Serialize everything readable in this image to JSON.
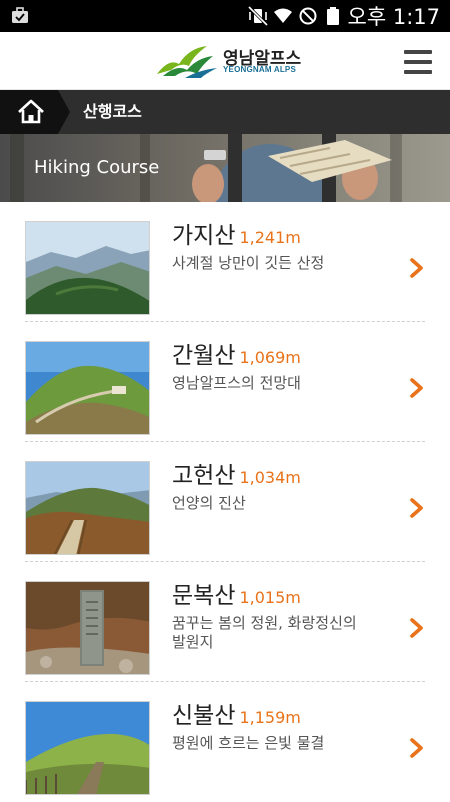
{
  "status_bar": {
    "time": "오후 1:17",
    "icons": [
      "briefcase-icon",
      "mute-vibrate-icon",
      "wifi-icon",
      "no-signal-icon",
      "battery-icon"
    ]
  },
  "header": {
    "logo_ko": "영남알프스",
    "logo_en": "YEONGNAM ALPS",
    "menu_icon": "hamburger-menu-icon",
    "logo_colors": [
      "#79b51c",
      "#2a8a3a",
      "#1a6f95"
    ]
  },
  "breadcrumb": {
    "home_icon": "home-icon",
    "label": "산행코스"
  },
  "hero": {
    "title": "Hiking Course"
  },
  "mountains": [
    {
      "name": "가지산",
      "height": "1,241m",
      "desc": [
        "사계절 낭만이 깃든 산정"
      ]
    },
    {
      "name": "간월산",
      "height": "1,069m",
      "desc": [
        "영남알프스의 전망대"
      ]
    },
    {
      "name": "고헌산",
      "height": "1,034m",
      "desc": [
        "언양의 진산"
      ]
    },
    {
      "name": "문복산",
      "height": "1,015m",
      "desc": [
        "꿈꾸는 봄의 정원, 화랑정신의",
        "발원지"
      ]
    },
    {
      "name": "신불산",
      "height": "1,159m",
      "desc": [
        "평원에 흐르는 은빛 물결"
      ]
    }
  ],
  "colors": {
    "accent": "#e8731a",
    "breadcrumb_bg": "#2e2e2e",
    "text": "#222222",
    "subtext": "#555555"
  }
}
